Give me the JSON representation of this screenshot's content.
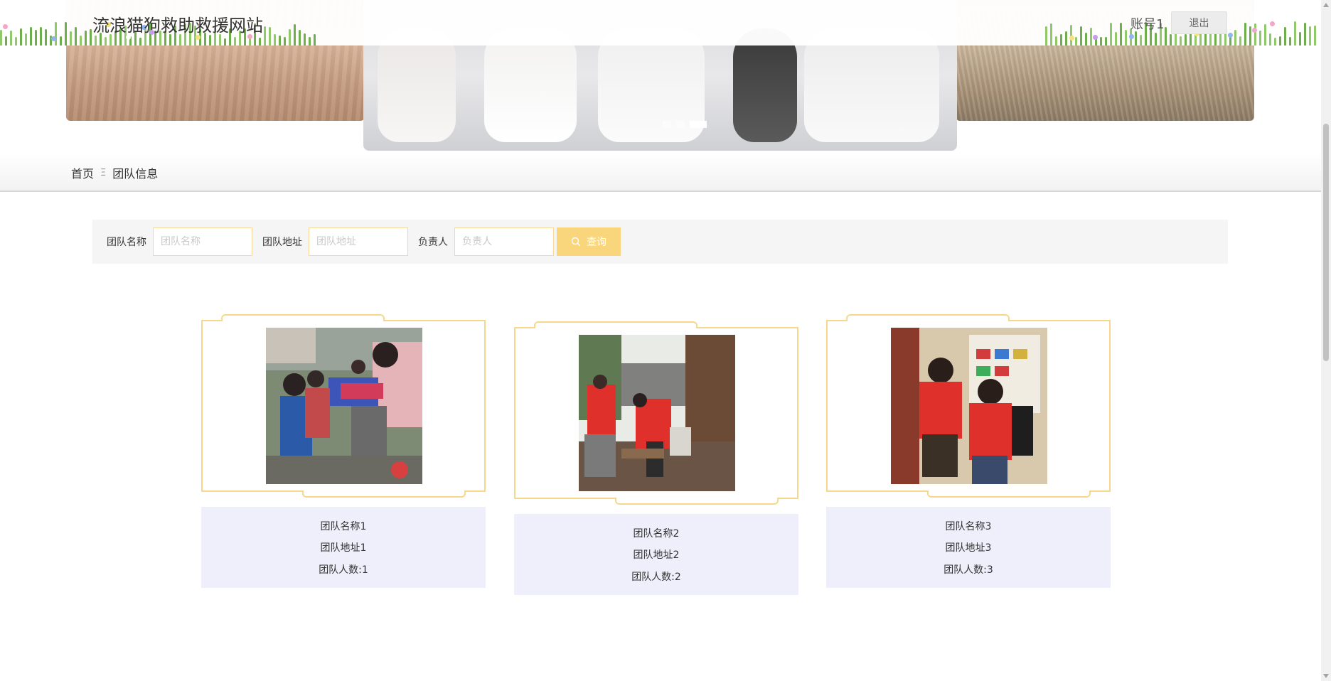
{
  "header": {
    "site_title": "流浪猫狗救助救援网站",
    "account": "账号1",
    "logout_label": "退出"
  },
  "carousel": {
    "slide_count": 3,
    "active_index": 2
  },
  "breadcrumb": {
    "home": "首页",
    "separator": "Ξ",
    "current": "团队信息"
  },
  "search": {
    "fields": [
      {
        "label": "团队名称",
        "placeholder": "团队名称",
        "value": ""
      },
      {
        "label": "团队地址",
        "placeholder": "团队地址",
        "value": ""
      },
      {
        "label": "负责人",
        "placeholder": "负责人",
        "value": ""
      }
    ],
    "button_label": "查询",
    "button_icon": "search-icon"
  },
  "teams": [
    {
      "name": "团队名称1",
      "address": "团队地址1",
      "members": "团队人数:1"
    },
    {
      "name": "团队名称2",
      "address": "团队地址2",
      "members": "团队人数:2"
    },
    {
      "name": "团队名称3",
      "address": "团队地址3",
      "members": "团队人数:3"
    }
  ],
  "colors": {
    "accent": "#f9d57c",
    "card_border": "#f6d88c",
    "info_bg": "#efeefb",
    "search_bg": "#f5f5f5"
  }
}
